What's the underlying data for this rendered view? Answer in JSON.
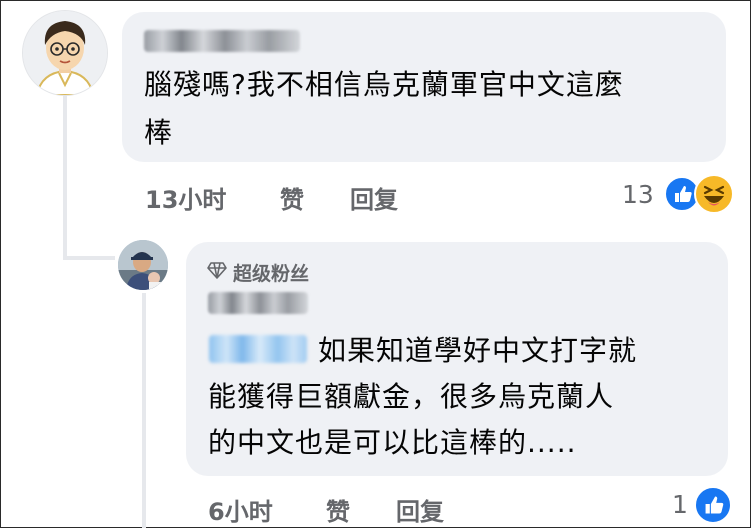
{
  "comment": {
    "text_line1": "腦殘嗎?我不相信烏克蘭軍官中文這麼",
    "text_line2": "棒",
    "time": "13小时",
    "like_label": "赞",
    "reply_label": "回复",
    "reaction_count": "13",
    "reactions": [
      "like-icon",
      "haha-icon"
    ]
  },
  "reply": {
    "badge_icon": "diamond-icon",
    "badge_label": "超级粉丝",
    "text_line1": "如果知道學好中文打字就",
    "text_line2": "能獲得巨額獻金，很多烏克蘭人",
    "text_line3": "的中文也是可以比這棒的.....",
    "time": "6小时",
    "like_label": "赞",
    "reply_label": "回复",
    "reaction_count": "1",
    "reactions": [
      "like-icon"
    ]
  },
  "colors": {
    "bubble": "#eff1f5",
    "meta_text": "#65676b",
    "like_blue": "#1877f2",
    "haha_yellow": "#f7b928",
    "mention_blue": "#8fc3ef"
  }
}
